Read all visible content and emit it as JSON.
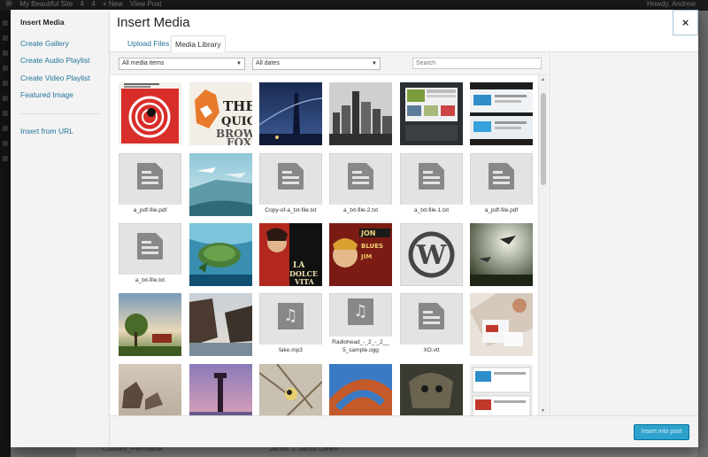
{
  "admin_bar": {
    "site_name": "My Beautiful Site",
    "updates": "4",
    "comments": "4",
    "new_label": "+ New",
    "view_post": "View Post",
    "howdy": "Howdy, Andrew"
  },
  "background": {
    "row_left": "Custom_Permalink",
    "row_right": "Jacob: 1 Jacob Lorem"
  },
  "modal": {
    "title": "Insert Media",
    "close_symbol": "×",
    "menu": {
      "insert_media": "Insert Media",
      "create_gallery": "Create Gallery",
      "create_audio_playlist": "Create Audio Playlist",
      "create_video_playlist": "Create Video Playlist",
      "featured_image": "Featured Image",
      "insert_from_url": "Insert from URL"
    },
    "tabs": {
      "upload": "Upload Files",
      "library": "Media Library"
    },
    "filters": {
      "type_value": "All media items",
      "date_value": "All dates",
      "search_placeholder": "Search"
    },
    "insert_button": "Insert into post",
    "accent_color": "#2ea2cc"
  },
  "attachments": {
    "r1": [
      "image",
      "image",
      "image",
      "image",
      "image",
      "image"
    ],
    "r2": [
      "a_pdf-file.pdf",
      "image",
      "Copy-of-a_txt-file.txt",
      "a_txt-file-2.txt",
      "a_txt-file-1.txt",
      "a_pdf-file.pdf"
    ],
    "r3": [
      "a_txt-file.txt",
      "image",
      "image",
      "image",
      "image",
      "image"
    ],
    "r4": [
      "image",
      "image",
      "fake.mp3",
      "Radiohead_-_2_-_2__5_sample.ogg",
      "XO.vtt",
      "image"
    ]
  },
  "icons": {
    "document": "document-icon",
    "audio": "audio-icon",
    "wordpress": "wordpress-logo"
  }
}
